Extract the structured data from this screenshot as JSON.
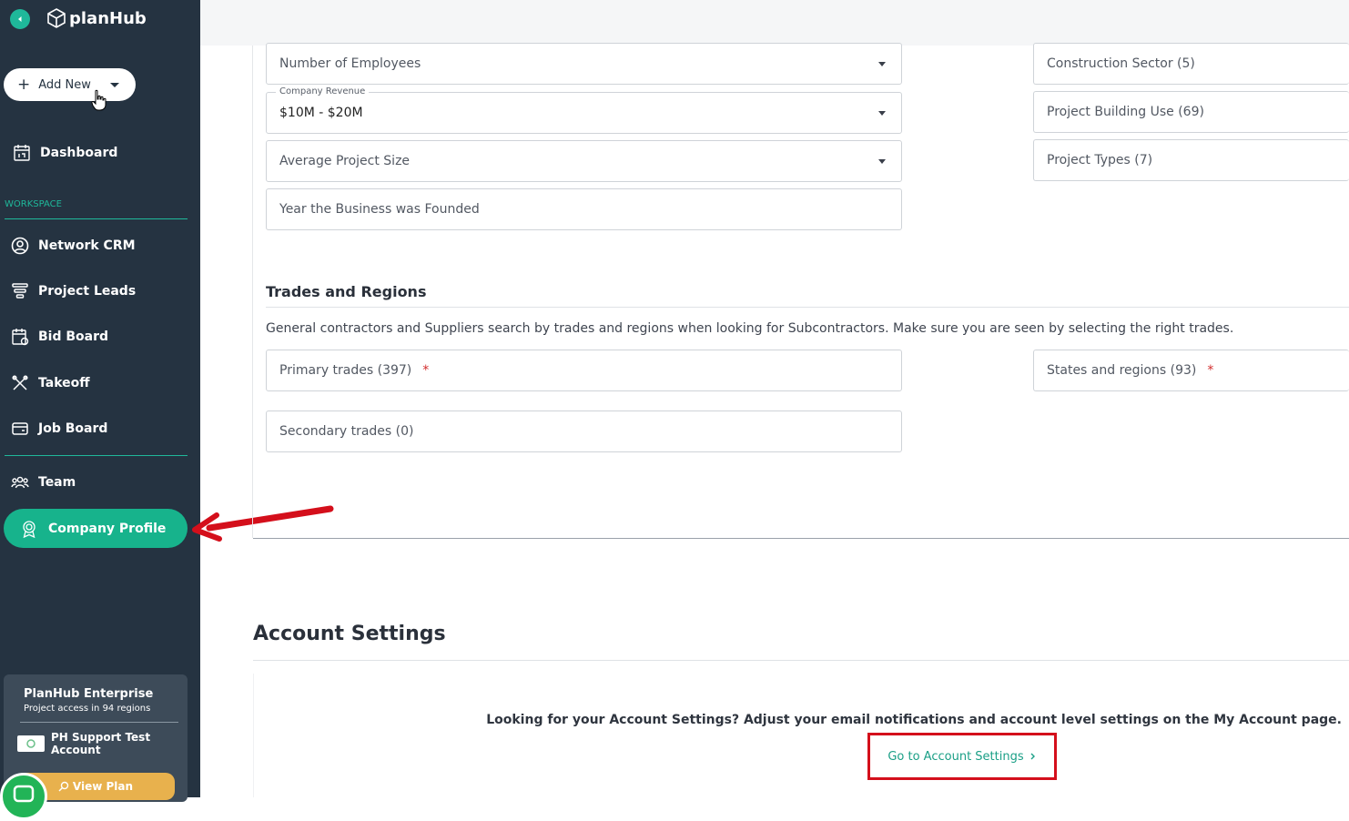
{
  "app": {
    "brand": "planHub"
  },
  "sidebar": {
    "add_new_label": "Add New",
    "dashboard_label": "Dashboard",
    "workspace_label": "WORKSPACE",
    "items": [
      {
        "label": "Network CRM",
        "icon": "user-circle-icon"
      },
      {
        "label": "Project Leads",
        "icon": "funnel-icon"
      },
      {
        "label": "Bid Board",
        "icon": "calendar-board-icon"
      },
      {
        "label": "Takeoff",
        "icon": "takeoff-tools-icon"
      },
      {
        "label": "Job Board",
        "icon": "card-icon"
      }
    ],
    "team_label": "Team",
    "company_profile_label": "Company Profile",
    "plan": {
      "title": "PlanHub Enterprise",
      "subtitle": "Project access in 94 regions",
      "account_name": "PH Support Test Account",
      "view_plan_label": "View Plan"
    }
  },
  "profile_fields": {
    "employees_placeholder": "Number of Employees",
    "revenue_legend": "Company Revenue",
    "revenue_value": "$10M - $20M",
    "avg_project_size_placeholder": "Average Project Size",
    "year_founded_placeholder": "Year the Business was Founded",
    "construction_sector": "Construction Sector (5)",
    "building_use": "Project Building Use (69)",
    "project_types": "Project Types (7)"
  },
  "trades_regions": {
    "heading": "Trades and Regions",
    "description": "General contractors and Suppliers search by trades and regions when looking for Subcontractors. Make sure you are seen by selecting the right trades.",
    "primary_trades": "Primary trades (397)",
    "states_regions": "States and regions (93)",
    "secondary_trades": "Secondary trades (0)",
    "required_mark": "*"
  },
  "account_settings": {
    "heading": "Account Settings",
    "message": "Looking for your Account Settings? Adjust your email notifications and account level settings on the My Account page.",
    "button_label": "Go to Account Settings"
  },
  "colors": {
    "sidebar": "#253341",
    "accent": "#17b38c",
    "highlight_red": "#d40f1b",
    "plan_button": "#e8b14d"
  }
}
